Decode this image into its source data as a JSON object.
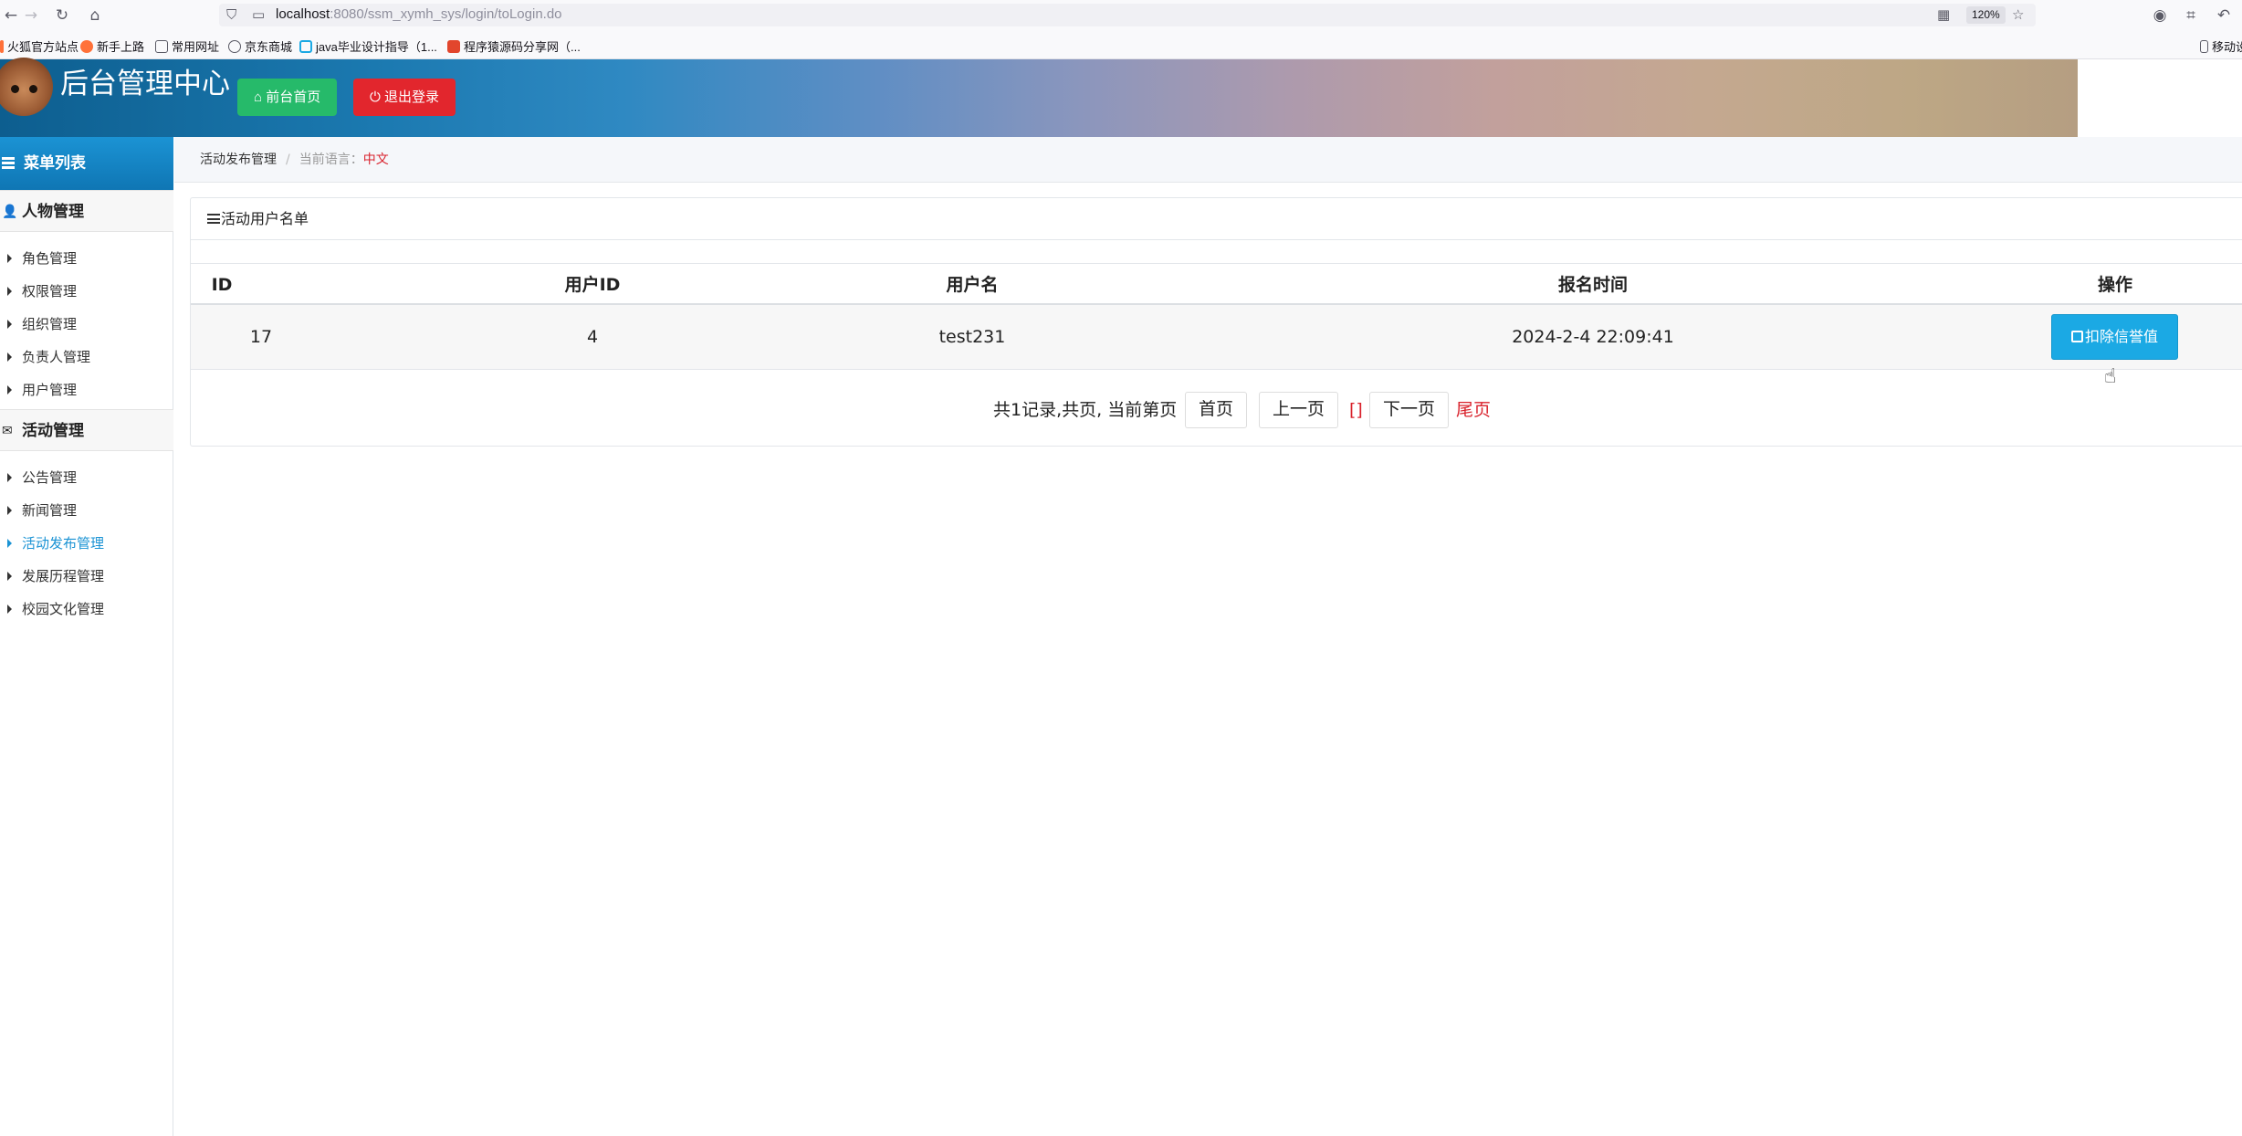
{
  "browser": {
    "url_host": "localhost",
    "url_path": ":8080/ssm_xymh_sys/login/toLogin.do",
    "zoom": "120%",
    "bookmarks": [
      "火狐官方站点",
      "新手上路",
      "常用网址",
      "京东商城",
      "java毕业设计指导（1...",
      "程序猿源码分享网（..."
    ],
    "bookmark_right": "移动设备上的书签"
  },
  "header": {
    "title": "后台管理中心",
    "home_button": "前台首页",
    "logout_button": "退出登录"
  },
  "sidebar": {
    "title": "菜单列表",
    "groups": [
      {
        "title": "人物管理",
        "items": [
          "角色管理",
          "权限管理",
          "组织管理",
          "负责人管理",
          "用户管理"
        ]
      },
      {
        "title": "活动管理",
        "items": [
          "公告管理",
          "新闻管理",
          "活动发布管理",
          "发展历程管理",
          "校园文化管理"
        ]
      }
    ],
    "active_item": "活动发布管理"
  },
  "breadcrumb": {
    "current": "活动发布管理",
    "lang_label": "当前语言：",
    "lang_value": "中文"
  },
  "panel": {
    "title": "活动用户名单",
    "columns": [
      "ID",
      "用户ID",
      "用户名",
      "报名时间",
      "操作"
    ],
    "rows": [
      {
        "id": "17",
        "user_id": "4",
        "username": "test231",
        "signup_time": "2024-2-4 22:09:41",
        "action": "扣除信誉值"
      }
    ],
    "pager": {
      "info": "共1记录,共页, 当前第页",
      "first": "首页",
      "prev": "上一页",
      "pages": "[]",
      "next": "下一页",
      "last": "尾页"
    }
  },
  "colors": {
    "sidebar_head": "#1b93d4",
    "home_button": "#26ba6a",
    "logout_button": "#e2262d",
    "action_button": "#1ba9e4",
    "accent_red": "#d9232d"
  }
}
